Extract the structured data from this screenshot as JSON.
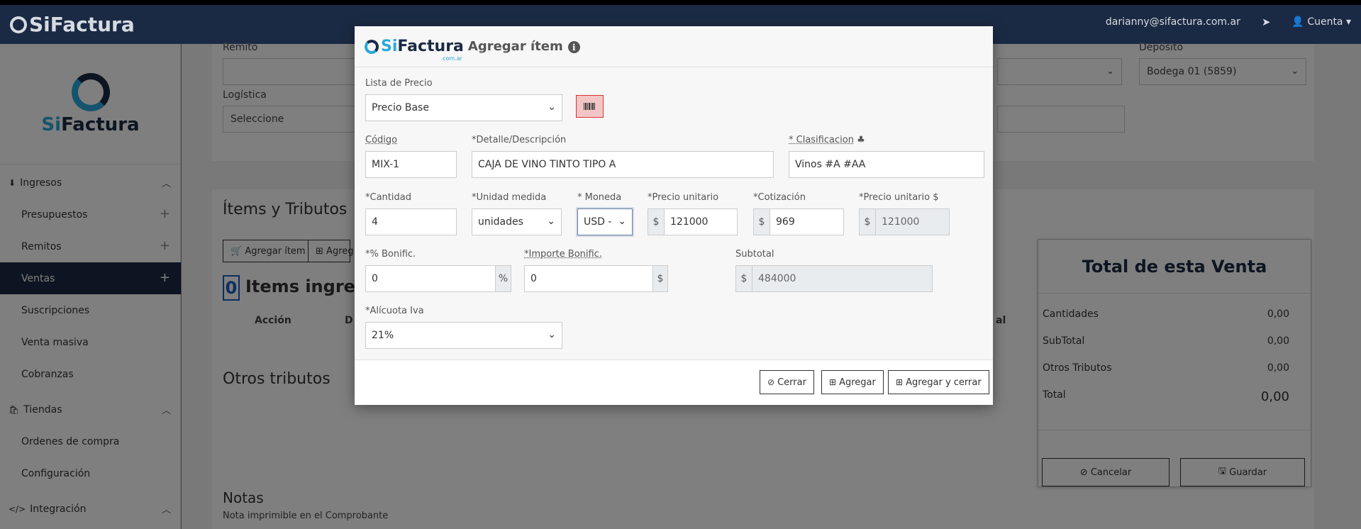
{
  "topbar": {
    "brand": "SiFactura",
    "email": "darianny@sifactura.com.ar",
    "account": "Cuenta"
  },
  "sidebar": {
    "logo_si": "Si",
    "logo_factura": "Factura",
    "sections": [
      {
        "label": "Ingresos"
      },
      {
        "label": "Tiendas"
      },
      {
        "label": "Integración"
      }
    ],
    "items": [
      {
        "label": "Presupuestos"
      },
      {
        "label": "Remitos"
      },
      {
        "label": "Ventas"
      },
      {
        "label": "Suscripciones"
      },
      {
        "label": "Venta masiva"
      },
      {
        "label": "Cobranzas"
      },
      {
        "label": "Ordenes de compra"
      },
      {
        "label": "Configuración"
      }
    ]
  },
  "background": {
    "remito_label": "Remito",
    "logistica_label": "Logística",
    "logistica_value": "Seleccione",
    "deposito_label": "Depósito",
    "deposito_value": "Bodega 01 (5859)",
    "items_title": "Ítems y Tributos",
    "agregar_item_btn": "Agregar ítem",
    "agregar_btn_partial": "Agreg",
    "items_count": "0",
    "items_ingresados": "Items ingresac",
    "col_accion": "Acción",
    "col_d": "D",
    "col_al": "al",
    "otros_tributos_title": "Otros tributos",
    "notas_title": "Notas",
    "notas_sub": "Nota imprimible en el Comprobante"
  },
  "totals": {
    "title": "Total de esta Venta",
    "rows": [
      {
        "label": "Cantidades",
        "value": "0,00"
      },
      {
        "label": "SubTotal",
        "value": "0,00"
      },
      {
        "label": "Otros Tributos",
        "value": "0,00"
      },
      {
        "label": "Total",
        "value": "0,00"
      }
    ],
    "cancel_label": "Cancelar",
    "save_label": "Guardar"
  },
  "modal": {
    "logo_si": "Si",
    "logo_factura": "Factura",
    "logo_com": ".com.ar",
    "title": "Agregar ítem",
    "lista_precio_label": "Lista de Precio",
    "lista_precio_value": "Precio Base",
    "codigo_label": "Código",
    "codigo_value": "MIX-1",
    "detalle_label": "*Detalle/Descripción",
    "detalle_value": "CAJA DE VINO TINTO TIPO A",
    "clasificacion_label": "* Clasificacion",
    "clasificacion_value": "Vinos #A #AA",
    "cantidad_label": "*Cantidad",
    "cantidad_value": "4",
    "unidad_label": "*Unidad medida",
    "unidad_value": "unidades",
    "moneda_label": "* Moneda",
    "moneda_value": "USD -",
    "precio_unit_label": "*Precio unitario",
    "precio_unit_value": "121000",
    "cotizacion_label": "*Cotización",
    "cotizacion_value": "969",
    "precio_unit_ars_label": "*Precio unitario $",
    "precio_unit_ars_value": "121000",
    "bonif_pct_label": "*% Bonific.",
    "bonif_pct_value": "0",
    "importe_bonif_label": "*Importe Bonific.",
    "importe_bonif_value": "0",
    "subtotal_label": "Subtotal",
    "subtotal_value": "484000",
    "alicuota_label": "*Alícuota Iva",
    "alicuota_value": "21%",
    "currency_symbol": "$",
    "percent_symbol": "%",
    "cerrar_label": "Cerrar",
    "agregar_label": "Agregar",
    "agregar_cerrar_label": "Agregar y cerrar"
  }
}
